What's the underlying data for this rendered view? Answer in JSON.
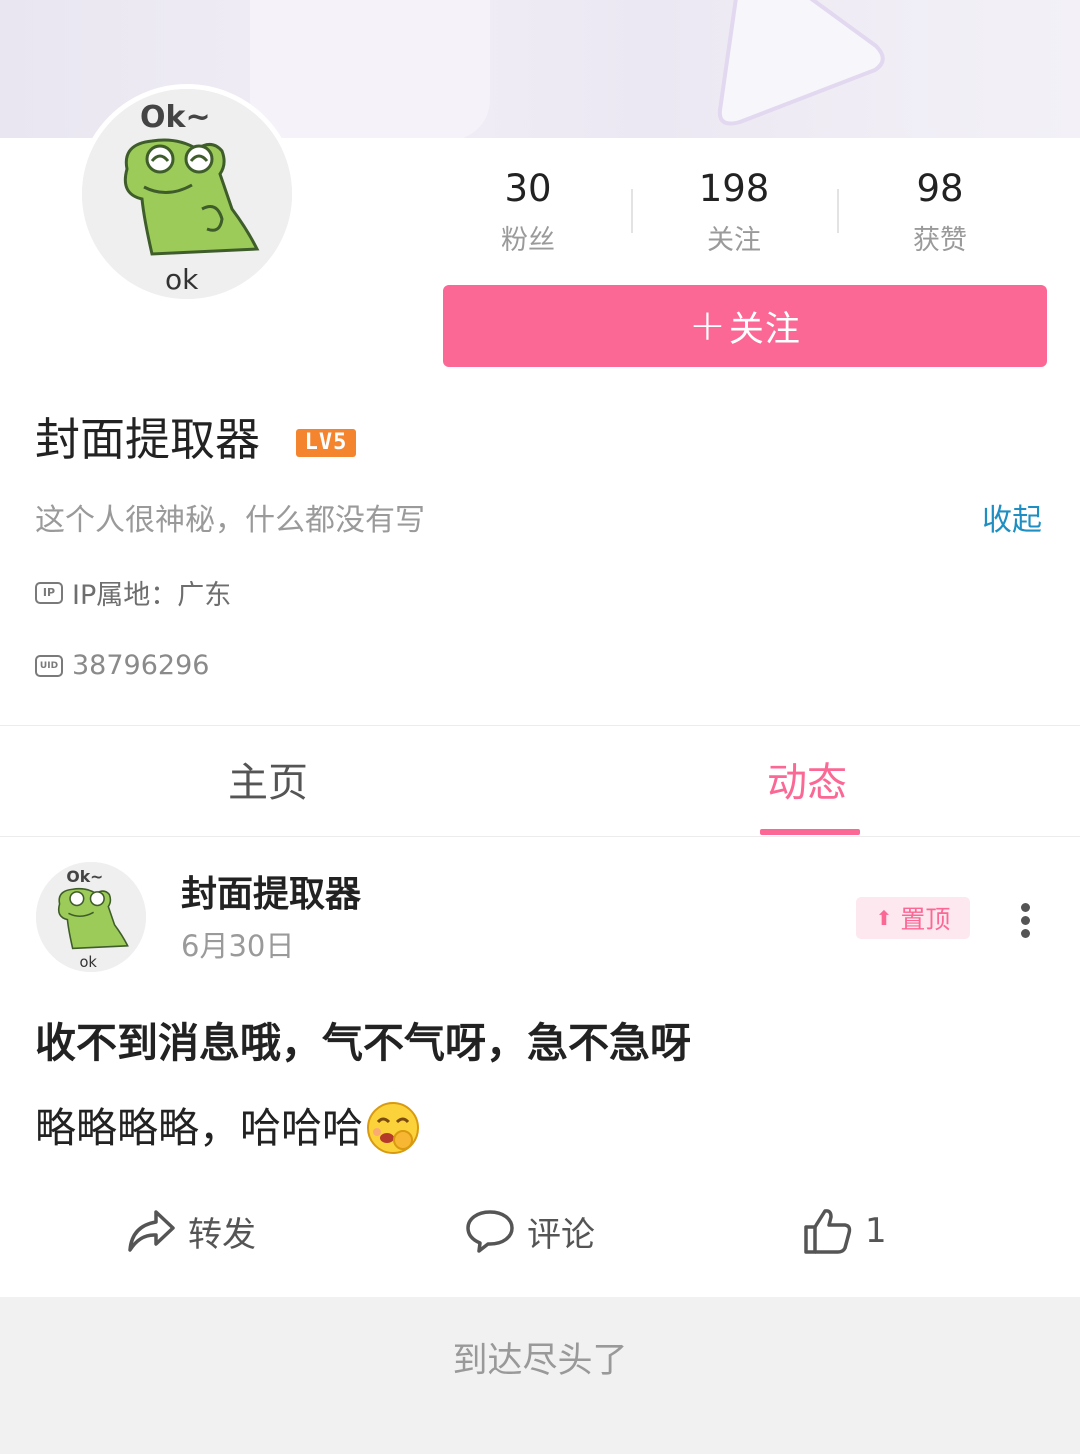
{
  "profile": {
    "avatar_caption": "ok",
    "username": "封面提取器",
    "level": "LV5",
    "bio": "这个人很神秘，什么都没有写",
    "collapse_label": "收起",
    "ip_tag": "IP",
    "ip_location": "IP属地：广东",
    "uid_tag": "UID",
    "uid": "38796296"
  },
  "stats": [
    {
      "value": "30",
      "label": "粉丝"
    },
    {
      "value": "198",
      "label": "关注"
    },
    {
      "value": "98",
      "label": "获赞"
    }
  ],
  "follow_button": {
    "label": "关注"
  },
  "tabs": [
    {
      "label": "主页",
      "active": false
    },
    {
      "label": "动态",
      "active": true
    }
  ],
  "post": {
    "author": "封面提取器",
    "date": "6月30日",
    "pinned_label": "置顶",
    "title": "收不到消息哦，气不气呀，急不急呀",
    "body": "略略略略，哈哈哈",
    "actions": {
      "repost": "转发",
      "comment": "评论",
      "like_count": "1"
    }
  },
  "footer": {
    "text": "到达尽头了"
  },
  "colors": {
    "accent_pink": "#fb6895",
    "link_blue": "#1f8fc3",
    "level_orange": "#f5842e"
  }
}
